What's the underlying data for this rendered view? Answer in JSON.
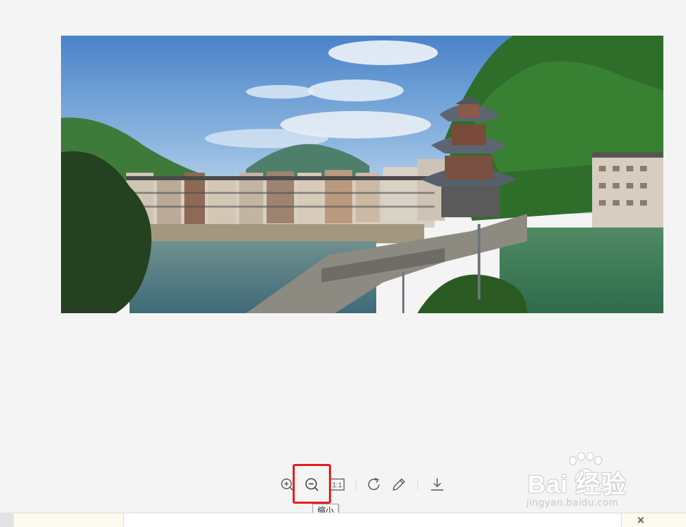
{
  "viewer": {
    "background": "#f4f4f4",
    "image": {
      "subject": "Fenghuang ancient town riverside with pagoda bridge tower"
    },
    "toolbar": {
      "buttons": [
        {
          "name": "zoom-in",
          "icon": "zoom-in-icon"
        },
        {
          "name": "zoom-out",
          "icon": "zoom-out-icon",
          "highlighted": true
        },
        {
          "name": "actual-size",
          "icon": "one-to-one-icon",
          "label": "1:1"
        },
        {
          "name": "rotate",
          "icon": "rotate-clockwise-icon"
        },
        {
          "name": "edit",
          "icon": "pencil-icon"
        },
        {
          "name": "download",
          "icon": "download-icon"
        }
      ],
      "tooltip": "缩小",
      "highlight_color": "#e8191e"
    },
    "watermark": {
      "logo_text": "Bai 经验",
      "url": "jingyan.baidu.com"
    },
    "bottom_bar": {
      "close_symbol": "×"
    }
  }
}
